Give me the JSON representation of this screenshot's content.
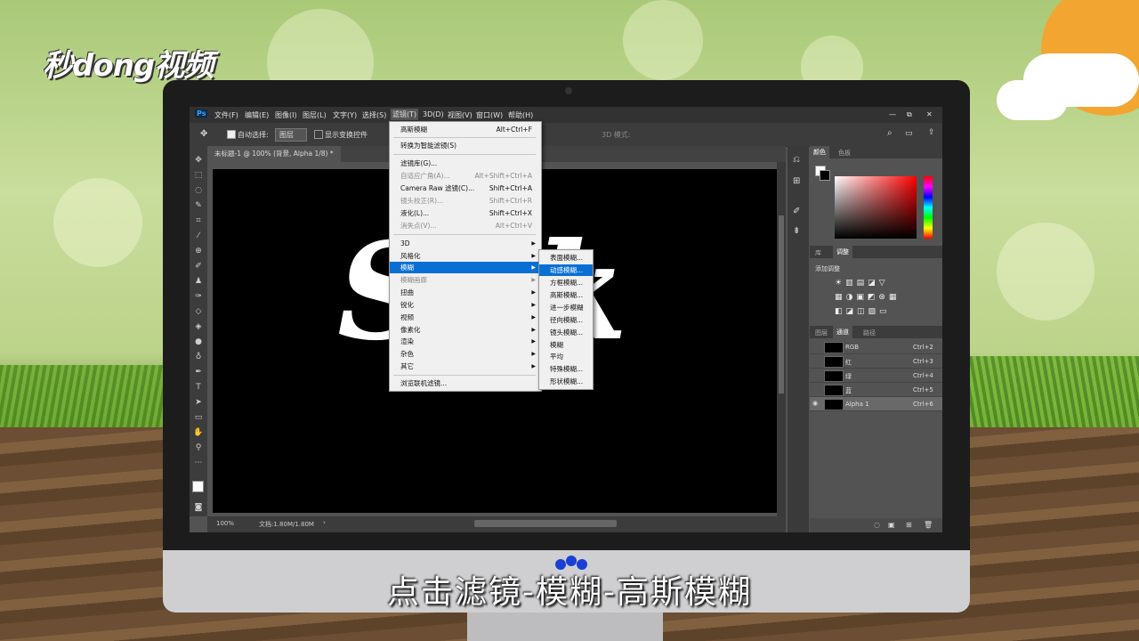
{
  "watermark": {
    "logo_text": "秒dong视频"
  },
  "subtitle": "点击滤镜-模糊-高斯模糊",
  "ps": {
    "app_icon": "Ps",
    "menubar": [
      "文件(F)",
      "编辑(E)",
      "图像(I)",
      "图层(L)",
      "文字(Y)",
      "选择(S)",
      "滤镜(T)",
      "3D(D)",
      "视图(V)",
      "窗口(W)",
      "帮助(H)"
    ],
    "window_controls": {
      "minimize": "—",
      "restore": "⧉",
      "close": "✕"
    },
    "options": {
      "auto_select_label": "自动选择:",
      "layer_select": "图层",
      "show_transform": "显示变换控件",
      "mode3d": "3D 模式:"
    },
    "doc_tab": "未标题-1 @ 100% (背景, Alpha 1/8) *",
    "canvas_text": "Silk",
    "status": {
      "zoom": "100%",
      "doc": "文档:1.80M/1.80M"
    },
    "panels": {
      "color_tabs": [
        "颜色",
        "色板"
      ],
      "adjust_tabs": [
        "库",
        "调整"
      ],
      "adjust_label": "添加调整",
      "channel_tabs": [
        "图层",
        "通道",
        "路径"
      ],
      "channels": [
        {
          "name": "RGB",
          "shortcut": "Ctrl+2"
        },
        {
          "name": "红",
          "shortcut": "Ctrl+3"
        },
        {
          "name": "绿",
          "shortcut": "Ctrl+4"
        },
        {
          "name": "蓝",
          "shortcut": "Ctrl+5"
        },
        {
          "name": "Alpha 1",
          "shortcut": "Ctrl+6"
        }
      ]
    },
    "filter_menu": {
      "items": [
        {
          "label": "高斯模糊",
          "shortcut": "Alt+Ctrl+F"
        },
        {
          "label": "转换为智能滤镜(S)"
        },
        {
          "label": "滤镜库(G)..."
        },
        {
          "label": "自适应广角(A)...",
          "shortcut": "Alt+Shift+Ctrl+A"
        },
        {
          "label": "Camera Raw 滤镜(C)...",
          "shortcut": "Shift+Ctrl+A"
        },
        {
          "label": "镜头校正(R)...",
          "shortcut": "Shift+Ctrl+R"
        },
        {
          "label": "液化(L)...",
          "shortcut": "Shift+Ctrl+X"
        },
        {
          "label": "消失点(V)...",
          "shortcut": "Alt+Ctrl+V"
        },
        {
          "label": "3D"
        },
        {
          "label": "风格化"
        },
        {
          "label": "模糊"
        },
        {
          "label": "模糊画廊"
        },
        {
          "label": "扭曲"
        },
        {
          "label": "锐化"
        },
        {
          "label": "视频"
        },
        {
          "label": "像素化"
        },
        {
          "label": "渲染"
        },
        {
          "label": "杂色"
        },
        {
          "label": "其它"
        },
        {
          "label": "浏览联机滤镜..."
        }
      ]
    },
    "blur_submenu": [
      "表面模糊...",
      "动感模糊...",
      "方框模糊...",
      "高斯模糊...",
      "进一步模糊",
      "径向模糊...",
      "镜头模糊...",
      "模糊",
      "平均",
      "特殊模糊...",
      "形状模糊..."
    ]
  }
}
